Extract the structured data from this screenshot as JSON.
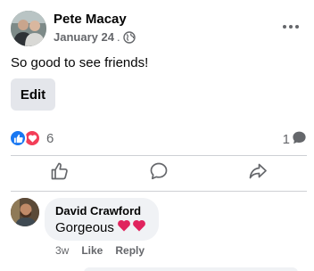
{
  "post": {
    "author": "Pete Macay",
    "date": "January 24",
    "separator": ".",
    "privacy_icon": "globe-icon",
    "text": "So good to see friends!",
    "edit_label": "Edit"
  },
  "stats": {
    "reaction_count": "6",
    "reaction_icons": [
      "like-icon",
      "love-icon"
    ],
    "comment_count": "1",
    "comment_icon": "speech-bubble-icon"
  },
  "actions": [
    "like-icon",
    "comment-icon",
    "share-icon"
  ],
  "comment": {
    "author": "David Crawford",
    "text": "Gorgeous",
    "emoji_icons": [
      "heart-icon",
      "heart-icon"
    ],
    "time": "3w",
    "like_label": "Like",
    "reply_label": "Reply"
  },
  "colors": {
    "primary_text": "#050505",
    "secondary_text": "#65676b",
    "like_blue": "#1877f2",
    "love_red": "#f33e58",
    "bubble_bg": "#f0f2f5",
    "button_bg": "#e4e6eb",
    "divider": "#ced0d4"
  }
}
